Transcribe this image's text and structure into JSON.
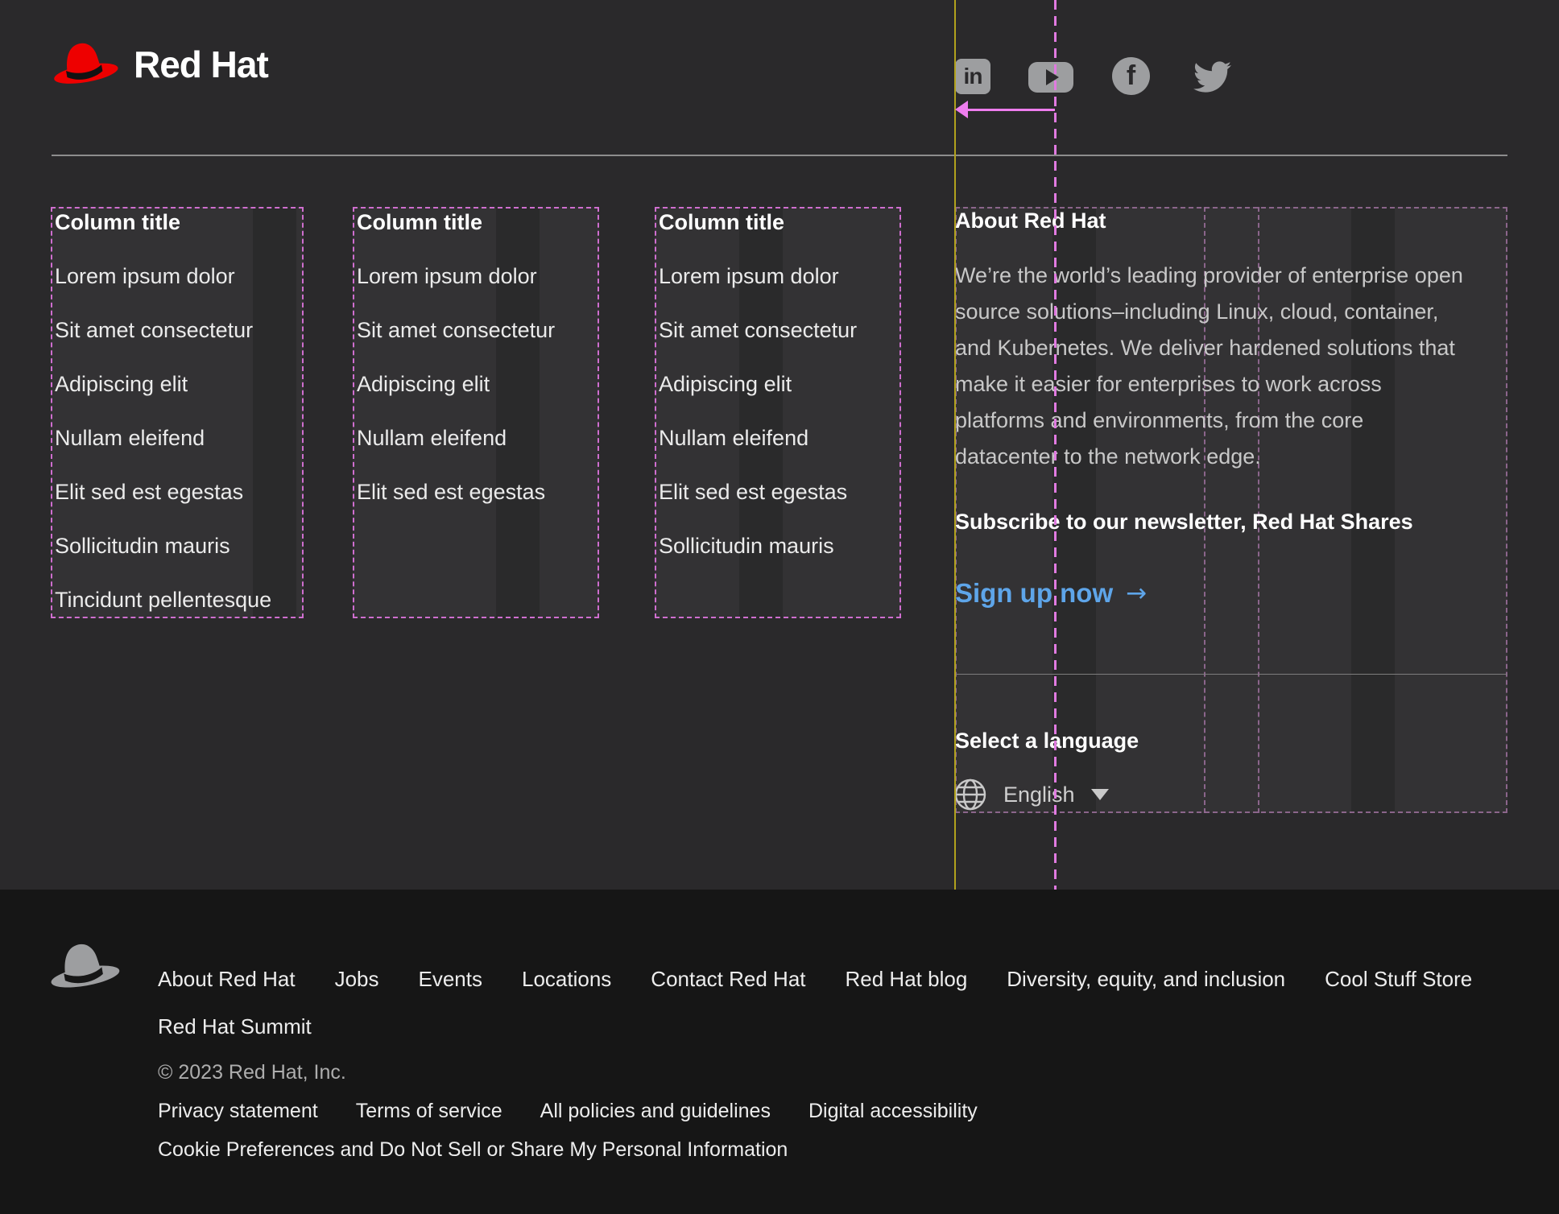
{
  "header": {
    "logo_text": "Red Hat",
    "social": [
      "LinkedIn",
      "YouTube",
      "Facebook",
      "Twitter"
    ]
  },
  "link_columns": [
    {
      "title": "Column title",
      "links": [
        "Lorem ipsum dolor",
        "Sit amet consectetur",
        "Adipiscing elit",
        "Nullam eleifend",
        "Elit sed est egestas",
        "Sollicitudin mauris",
        "Tincidunt pellentesque"
      ]
    },
    {
      "title": "Column title",
      "links": [
        "Lorem ipsum dolor",
        "Sit amet consectetur",
        "Adipiscing elit",
        "Nullam eleifend",
        "Elit sed est egestas"
      ]
    },
    {
      "title": "Column title",
      "links": [
        "Lorem ipsum dolor",
        "Sit amet consectetur",
        "Adipiscing elit",
        "Nullam eleifend",
        "Elit sed est egestas",
        "Sollicitudin mauris"
      ]
    }
  ],
  "about": {
    "title": "About Red Hat",
    "body_lines": [
      "We’re the world’s leading provider of enterprise open",
      "source solutions–including Linux, cloud, container,",
      "and Kubernetes. We deliver hardened solutions that",
      "make it easier for enterprises to work across",
      "platforms and environments, from the core",
      "datacenter to the network edge."
    ],
    "subscribe": "Subscribe to our newsletter, Red Hat Shares",
    "signup": "Sign up now",
    "signup_arrow": "→"
  },
  "language": {
    "title": "Select a language",
    "current": "English"
  },
  "bottom": {
    "nav_row1": [
      "About Red Hat",
      "Jobs",
      "Events",
      "Locations",
      "Contact Red Hat",
      "Red Hat blog",
      "Diversity, equity, and inclusion",
      "Cool Stuff Store"
    ],
    "nav_row2": [
      "Red Hat Summit"
    ],
    "copyright": "© 2023 Red Hat, Inc.",
    "legal": [
      "Privacy statement",
      "Terms of service",
      "All policies and guidelines",
      "Digital accessibility"
    ],
    "cookie": "Cookie Preferences and Do Not Sell or Share My Personal Information"
  },
  "colors": {
    "accent_blue": "#5ea5e9",
    "guide_magenta": "#e07ae0",
    "guide_purple_dim": "#9b6f9b",
    "guide_yellow": "#b1a11d",
    "icon_gray": "#9d9ea0",
    "upper_bg": "#2a292b",
    "lower_bg": "#161616"
  }
}
